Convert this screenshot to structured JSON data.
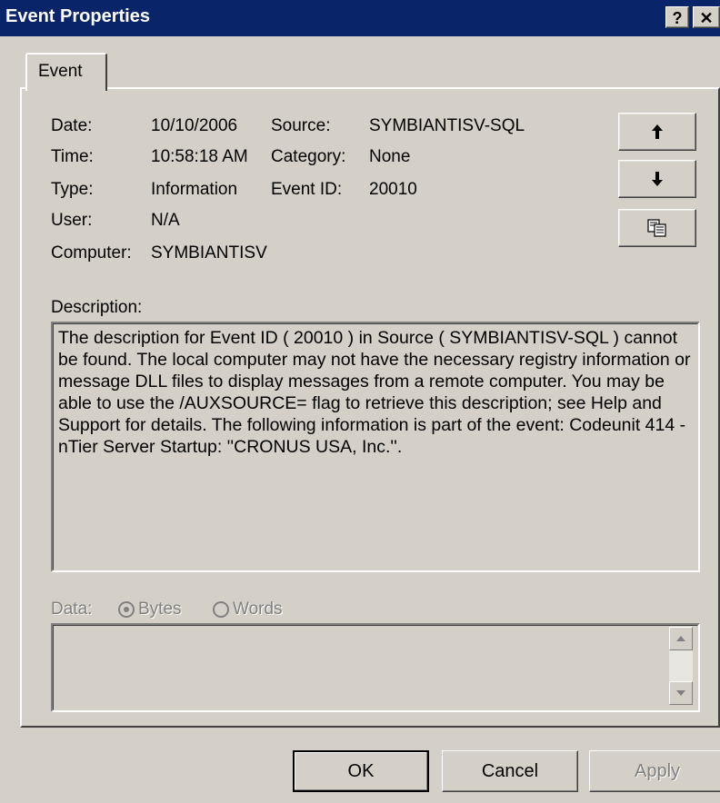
{
  "window": {
    "title": "Event Properties",
    "help_glyph": "?",
    "close_glyph": "✕"
  },
  "tab": {
    "label": "Event"
  },
  "fields": {
    "date_label": "Date:",
    "date_value": "10/10/2006",
    "time_label": "Time:",
    "time_value": "10:58:18 AM",
    "type_label": "Type:",
    "type_value": "Information",
    "user_label": "User:",
    "user_value": "N/A",
    "computer_label": "Computer:",
    "computer_value": "SYMBIANTISV",
    "source_label": "Source:",
    "source_value": "SYMBIANTISV-SQL",
    "category_label": "Category:",
    "category_value": "None",
    "eventid_label": "Event ID:",
    "eventid_value": "20010"
  },
  "nav": {
    "up_icon": "arrow-up-icon",
    "down_icon": "arrow-down-icon",
    "copy_icon": "copy-icon"
  },
  "description": {
    "label": "Description:",
    "text": "The description for Event ID ( 20010 ) in Source ( SYMBIANTISV-SQL ) cannot be found. The local computer may not have the necessary registry information or message DLL files to display messages from a remote computer. You may be able to use the /AUXSOURCE= flag to retrieve this description; see Help and Support for details. The following information is part of the event: Codeunit 414 - nTier Server Startup: ''CRONUS USA, Inc.''."
  },
  "data": {
    "label": "Data:",
    "bytes_label": "Bytes",
    "words_label": "Words",
    "selected": "Bytes"
  },
  "buttons": {
    "ok": "OK",
    "cancel": "Cancel",
    "apply": "Apply"
  }
}
